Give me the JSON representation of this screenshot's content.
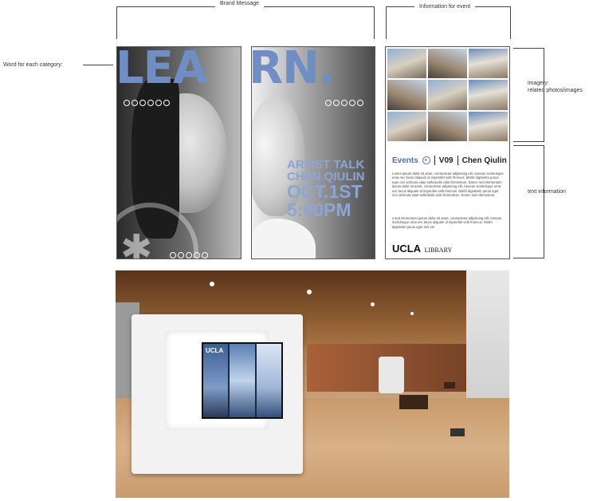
{
  "annotations": {
    "brand_message": "Brand Message",
    "information_for_event": "Information for event",
    "word_for_category": "Word for each category:",
    "imagery_line1": "imagery:",
    "imagery_line2": "related photos/images",
    "text_information": "text information"
  },
  "poster": {
    "word_left": "LEA",
    "word_right": "RN.",
    "talk_line1": "ARTIST TALK",
    "talk_line2": "CHEN QIULIN",
    "talk_line3": "OCT.1ST",
    "talk_line4": "5:00PM"
  },
  "event_panel": {
    "events_label": "Events",
    "code": "V09",
    "artist": "Chen Qiulin",
    "body1": "Lorem ipsum dolor sit amet, consectetur adipiscing elit. Aenean scelerisque urna nec lacus aliquam id imperdiet velit rhoncus. Morbi dignissim purus eget orci vehicula vitae sollicitudin odio fermentum. Donec sed elementum ipsum dolor sit amet, consectetur adipiscing elit. Aenean scelerisque urna nec lacus aliquam id imperdiet velit rhoncus. Morbi dignissim purus eget orci vehicula vitae sollicitudin odio fermentum. Donec sed elementum.",
    "body2": "s sed elementum ipsum dolor sit amet, consectetur adipiscing elit. Aenean scelerisque urna nec lacus aliquam id imperdiet velit rhoncus. Morbi dignissim purus eget orci vel",
    "logo_bold": "UCLA",
    "logo_rest": "LIBRARY"
  },
  "photo": {
    "screen_logo": "UCLA"
  },
  "colors": {
    "accent_blue": "#6f8ec4",
    "event_blue": "#4a6fb0"
  }
}
